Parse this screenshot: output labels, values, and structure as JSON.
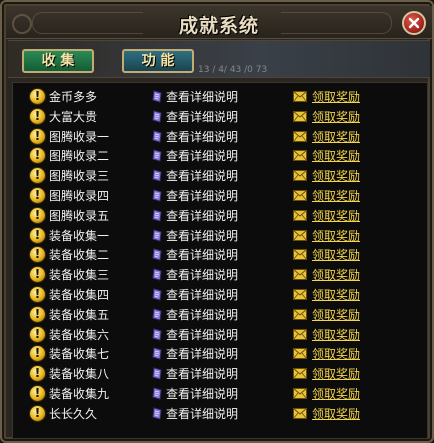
{
  "window": {
    "title": "成就系统"
  },
  "tabs": [
    {
      "label": "收 集",
      "active": true
    },
    {
      "label": "功 能",
      "active": false
    }
  ],
  "tab_hint": "13 / 4/ 43 /0 73",
  "colors": {
    "active_tab": "#1f7a47",
    "inactive_tab": "#245a69",
    "reward_link": "#f3d44a",
    "text": "#f2f2f2"
  },
  "achievements": [
    {
      "name": "金币多多",
      "detail": "查看详细说明",
      "reward": "领取奖励"
    },
    {
      "name": "大富大贵",
      "detail": "查看详细说明",
      "reward": "领取奖励"
    },
    {
      "name": "图腾收录一",
      "detail": "查看详细说明",
      "reward": "领取奖励"
    },
    {
      "name": "图腾收录二",
      "detail": "查看详细说明",
      "reward": "领取奖励"
    },
    {
      "name": "图腾收录三",
      "detail": "查看详细说明",
      "reward": "领取奖励"
    },
    {
      "name": "图腾收录四",
      "detail": "查看详细说明",
      "reward": "领取奖励"
    },
    {
      "name": "图腾收录五",
      "detail": "查看详细说明",
      "reward": "领取奖励"
    },
    {
      "name": "装备收集一",
      "detail": "查看详细说明",
      "reward": "领取奖励"
    },
    {
      "name": "装备收集二",
      "detail": "查看详细说明",
      "reward": "领取奖励"
    },
    {
      "name": "装备收集三",
      "detail": "查看详细说明",
      "reward": "领取奖励"
    },
    {
      "name": "装备收集四",
      "detail": "查看详细说明",
      "reward": "领取奖励"
    },
    {
      "name": "装备收集五",
      "detail": "查看详细说明",
      "reward": "领取奖励"
    },
    {
      "name": "装备收集六",
      "detail": "查看详细说明",
      "reward": "领取奖励"
    },
    {
      "name": "装备收集七",
      "detail": "查看详细说明",
      "reward": "领取奖励"
    },
    {
      "name": "装备收集八",
      "detail": "查看详细说明",
      "reward": "领取奖励"
    },
    {
      "name": "装备收集九",
      "detail": "查看详细说明",
      "reward": "领取奖励"
    },
    {
      "name": "长长久久",
      "detail": "查看详细说明",
      "reward": "领取奖励"
    }
  ]
}
